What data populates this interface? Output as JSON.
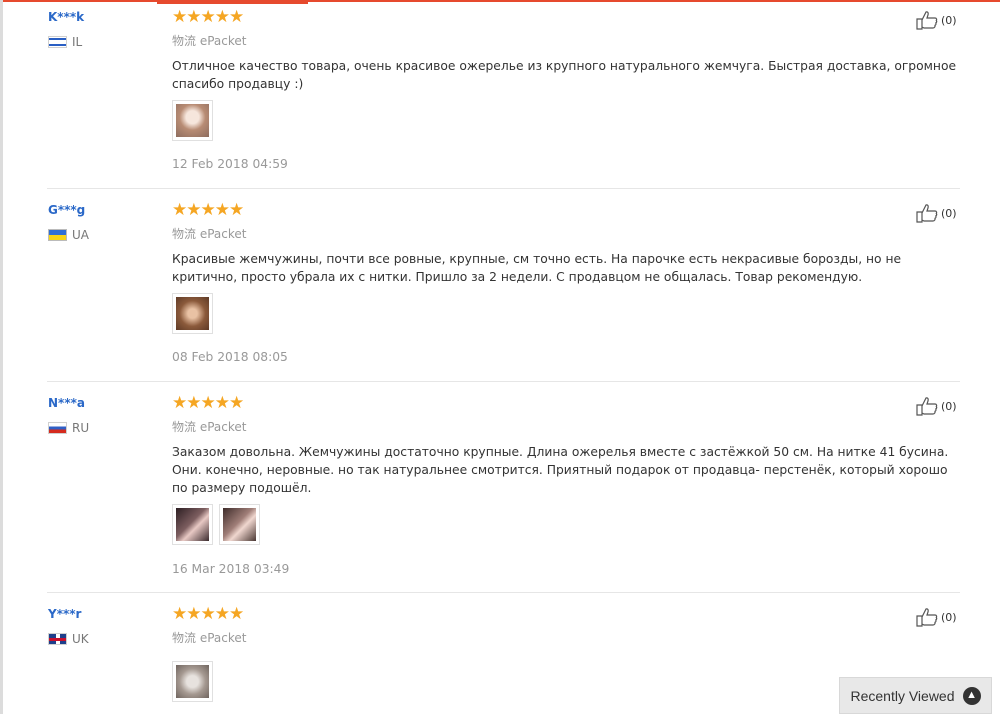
{
  "reviews": [
    {
      "user": "K***k",
      "country": "IL",
      "stars": "★★★★★",
      "shipping": "物流 ePacket",
      "text": "Отличное качество товара, очень красивое ожерелье из крупного натурального жемчуга. Быстрая доставка, огромное спасибо продавцу :)",
      "date": "12 Feb 2018 04:59",
      "likes": "(0)"
    },
    {
      "user": "G***g",
      "country": "UA",
      "stars": "★★★★★",
      "shipping": "物流 ePacket",
      "text": "Красивые жемчужины, почти все ровные, крупные, см точно есть. На парочке есть некрасивые борозды, но не критично, просто убрала их с нитки. Пришло за 2 недели. С продавцом не общалась. Товар рекомендую.",
      "date": "08 Feb 2018 08:05",
      "likes": "(0)"
    },
    {
      "user": "N***a",
      "country": "RU",
      "stars": "★★★★★",
      "shipping": "物流 ePacket",
      "text": "Заказом довольна. Жемчужины достаточно крупные. Длина ожерелья вместе с застёжкой 50 см. На нитке 41 бусина. Они. конечно, неровные. но так натуральнее смотрится. Приятный подарок от продавца- перстенёк, который хорошо по размеру подошёл.",
      "date": "16 Mar 2018 03:49",
      "likes": "(0)"
    },
    {
      "user": "Y***r",
      "country": "UK",
      "stars": "★★★★★",
      "shipping": "物流 ePacket",
      "text": "",
      "date": "",
      "likes": "(0)"
    }
  ],
  "recently_viewed": {
    "label": "Recently Viewed",
    "icon": "chevron-up-icon"
  },
  "colors": {
    "accent": "#e64a2e",
    "username": "#2a68c8",
    "stars": "#f5a623"
  }
}
